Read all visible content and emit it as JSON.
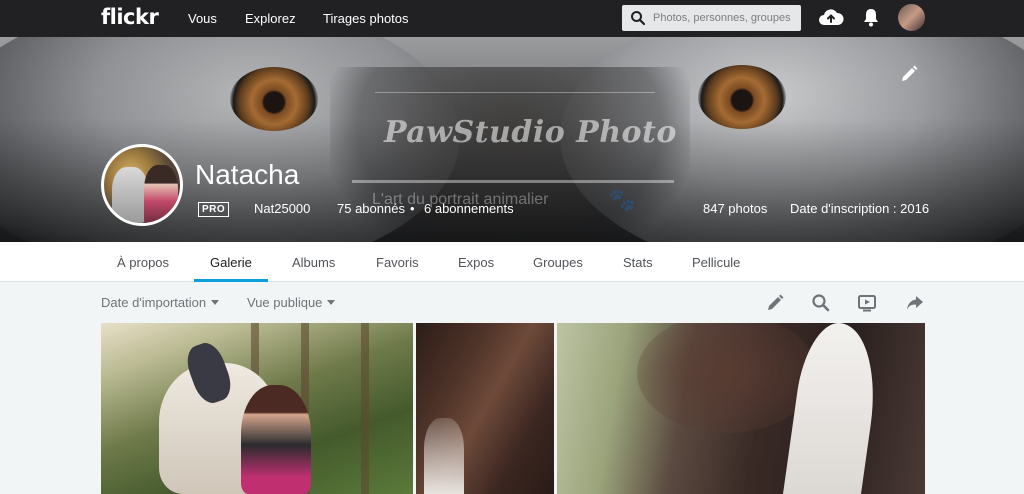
{
  "topnav": {
    "logo": "flickr",
    "links": [
      "Vous",
      "Explorez",
      "Tirages photos"
    ],
    "search_placeholder": "Photos, personnes, groupes",
    "icons": [
      "search-icon",
      "upload-cloud-icon",
      "bell-icon",
      "avatar"
    ]
  },
  "cover": {
    "watermark_title": "PawStudio Photo",
    "watermark_tagline": "L'art du portrait animalier",
    "edit_icon": "pencil-icon"
  },
  "profile": {
    "name": "Natacha",
    "badge": "PRO",
    "username": "Nat25000",
    "followers": "75 abonnés",
    "separator": "•",
    "following": "6 abonnements",
    "photos": "847 photos",
    "joined": "Date d'inscription : 2016"
  },
  "subnav": {
    "tabs": [
      "À propos",
      "Galerie",
      "Albums",
      "Favoris",
      "Expos",
      "Groupes",
      "Stats",
      "Pellicule"
    ],
    "active": "Galerie"
  },
  "toolbar": {
    "sort": "Date d'importation",
    "view": "Vue publique",
    "tools": [
      "pencil-icon",
      "search-icon",
      "slideshow-icon",
      "share-icon"
    ]
  },
  "colors": {
    "topbar": "#212124",
    "accent": "#0ba0db",
    "page_bg": "#f2f5f6"
  }
}
